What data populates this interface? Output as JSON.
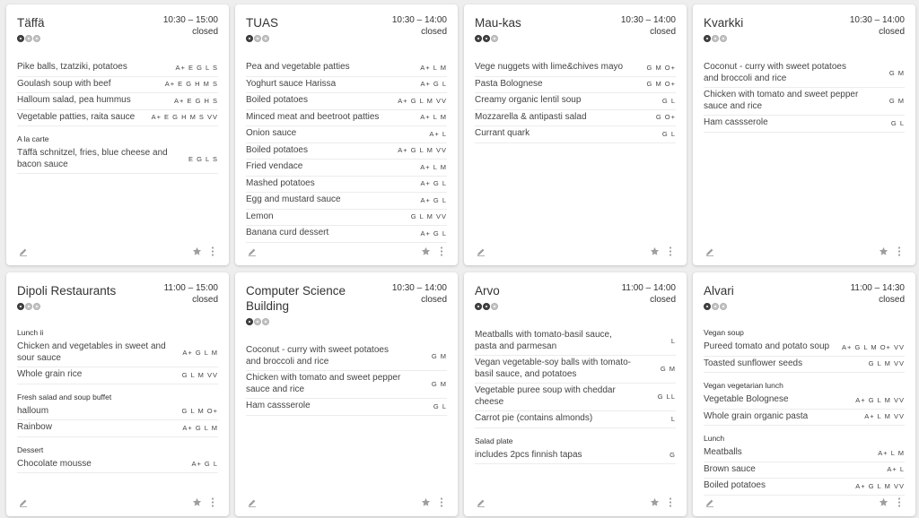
{
  "restaurants": [
    {
      "name": "Täffä",
      "price_level": 1,
      "hours": "10:30 – 15:00",
      "status": "closed",
      "sections": [
        {
          "title": "",
          "items": [
            {
              "name": "Pike balls, tzatziki, potatoes",
              "diet": "A+ E G L S"
            },
            {
              "name": "Goulash soup with beef",
              "diet": "A+ E G H M S"
            },
            {
              "name": "Halloum salad, pea hummus",
              "diet": "A+ E G H S"
            },
            {
              "name": "Vegetable patties, raita sauce",
              "diet": "A+ E G H M S VV"
            }
          ]
        },
        {
          "title": "A la carte",
          "items": [
            {
              "name": "Täffä schnitzel, fries, blue cheese and bacon sauce",
              "diet": "E G L S"
            }
          ]
        }
      ]
    },
    {
      "name": "TUAS",
      "price_level": 1,
      "hours": "10:30 – 14:00",
      "status": "closed",
      "sections": [
        {
          "title": "",
          "items": [
            {
              "name": "Pea and vegetable patties",
              "diet": "A+ L M"
            },
            {
              "name": "Yoghurt sauce Harissa",
              "diet": "A+ G L"
            },
            {
              "name": "Boiled potatoes",
              "diet": "A+ G L M VV"
            },
            {
              "name": "Minced meat and beetroot patties",
              "diet": "A+ L M"
            },
            {
              "name": "Onion sauce",
              "diet": "A+ L"
            },
            {
              "name": "Boiled potatoes",
              "diet": "A+ G L M VV"
            },
            {
              "name": "Fried vendace",
              "diet": "A+ L M"
            },
            {
              "name": "Mashed potatoes",
              "diet": "A+ G L"
            },
            {
              "name": "Egg and mustard sauce",
              "diet": "A+ G L"
            },
            {
              "name": "Lemon",
              "diet": "G L M VV"
            },
            {
              "name": "Banana curd dessert",
              "diet": "A+ G L"
            }
          ]
        }
      ]
    },
    {
      "name": "Mau-kas",
      "price_level": 2,
      "hours": "10:30 – 14:00",
      "status": "closed",
      "sections": [
        {
          "title": "",
          "items": [
            {
              "name": "Vege nuggets with lime&chives mayo",
              "diet": "G M O+"
            },
            {
              "name": "Pasta Bolognese",
              "diet": "G M O+"
            },
            {
              "name": "Creamy organic lentil soup",
              "diet": "G L"
            },
            {
              "name": "Mozzarella & antipasti salad",
              "diet": "G O+"
            },
            {
              "name": "Currant quark",
              "diet": "G L"
            }
          ]
        }
      ]
    },
    {
      "name": "Kvarkki",
      "price_level": 1,
      "hours": "10:30 – 14:00",
      "status": "closed",
      "sections": [
        {
          "title": "",
          "items": [
            {
              "name": "Coconut - curry with sweet potatoes and broccoli and rice",
              "diet": "G M"
            },
            {
              "name": "Chicken with tomato and sweet pepper sauce and rice",
              "diet": "G M"
            },
            {
              "name": "Ham cassserole",
              "diet": "G L"
            }
          ]
        }
      ]
    },
    {
      "name": "Dipoli Restaurants",
      "price_level": 1,
      "hours": "11:00 – 15:00",
      "status": "closed",
      "sections": [
        {
          "title": "Lunch ii",
          "items": [
            {
              "name": "Chicken and vegetables in sweet and sour sauce",
              "diet": "A+ G L M"
            },
            {
              "name": "Whole grain rice",
              "diet": "G L M VV"
            }
          ]
        },
        {
          "title": "Fresh salad and soup buffet",
          "items": [
            {
              "name": "halloum",
              "diet": "G L M O+"
            },
            {
              "name": "Rainbow",
              "diet": "A+ G L M"
            }
          ]
        },
        {
          "title": "Dessert",
          "items": [
            {
              "name": "Chocolate mousse",
              "diet": "A+ G L"
            }
          ]
        }
      ]
    },
    {
      "name": "Computer Science Building",
      "price_level": 1,
      "hours": "10:30 – 14:00",
      "status": "closed",
      "sections": [
        {
          "title": "",
          "items": [
            {
              "name": "Coconut - curry with sweet potatoes and broccoli and rice",
              "diet": "G M"
            },
            {
              "name": "Chicken with tomato and sweet pepper sauce and rice",
              "diet": "G M"
            },
            {
              "name": "Ham cassserole",
              "diet": "G L"
            }
          ]
        }
      ]
    },
    {
      "name": "Arvo",
      "price_level": 2,
      "hours": "11:00 – 14:00",
      "status": "closed",
      "sections": [
        {
          "title": "",
          "items": [
            {
              "name": "Meatballs with tomato-basil sauce, pasta and parmesan",
              "diet": "L"
            },
            {
              "name": "Vegan vegetable-soy balls with tomato-basil sauce, and potatoes",
              "diet": "G M"
            },
            {
              "name": "Vegetable puree soup with cheddar cheese",
              "diet": "G LL"
            },
            {
              "name": "Carrot pie (contains almonds)",
              "diet": "L"
            }
          ]
        },
        {
          "title": "Salad plate",
          "items": [
            {
              "name": "includes 2pcs finnish tapas",
              "diet": "G"
            }
          ]
        }
      ]
    },
    {
      "name": "Alvari",
      "price_level": 1,
      "hours": "11:00 – 14:30",
      "status": "closed",
      "sections": [
        {
          "title": "Vegan soup",
          "items": [
            {
              "name": "Pureed tomato and potato soup",
              "diet": "A+ G L M O+ VV"
            },
            {
              "name": "Toasted sunflower seeds",
              "diet": "G L M VV"
            }
          ]
        },
        {
          "title": "Vegan vegetarian lunch",
          "items": [
            {
              "name": "Vegetable Bolognese",
              "diet": "A+ G L M VV"
            },
            {
              "name": "Whole grain organic pasta",
              "diet": "A+ L M VV"
            }
          ]
        },
        {
          "title": "Lunch",
          "items": [
            {
              "name": "Meatballs",
              "diet": "A+ L M"
            },
            {
              "name": "Brown sauce",
              "diet": "A+ L"
            },
            {
              "name": "Boiled potatoes",
              "diet": "A+ G L M VV"
            }
          ]
        }
      ]
    }
  ],
  "icons": {
    "edit": "pencil-icon",
    "favorite": "star-icon",
    "more": "more-vertical-icon"
  },
  "colors": {
    "background": "#eeeeee",
    "card": "#ffffff",
    "text": "#333333",
    "icon": "#9e9e9e"
  }
}
